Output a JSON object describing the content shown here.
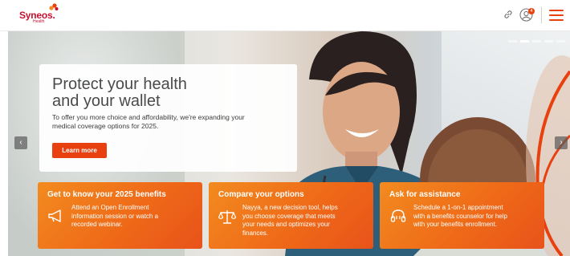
{
  "brand": {
    "name": "Syneos.",
    "sub": "Health",
    "accent": "#e8410f",
    "logo_red": "#c8102e"
  },
  "header": {
    "notification_count": "4",
    "icons": [
      "link-icon",
      "user-icon",
      "menu-icon"
    ]
  },
  "carousel": {
    "total_slides": 5,
    "active_slide": 2,
    "prev_label": "‹",
    "next_label": "›"
  },
  "promo": {
    "title_line1": "Protect your health",
    "title_line2": "and your wallet",
    "body_line1": "To offer you more choice and affordability, we're expanding your",
    "body_line2": "medical coverage options for 2025.",
    "cta_label": "Learn more"
  },
  "cards": [
    {
      "title": "Get to know your 2025 benefits",
      "icon": "megaphone-icon",
      "lines": [
        "Attend an Open Enrollment",
        "information session or watch a",
        "recorded webinar."
      ]
    },
    {
      "title": "Compare your options",
      "icon": "scales-icon",
      "lines": [
        "Nayya, a new decision tool, helps",
        "you choose coverage that meets",
        "your needs and optimizes your",
        "finances."
      ]
    },
    {
      "title": "Ask for assistance",
      "icon": "headset-icon",
      "lines": [
        "Schedule a 1-on-1 appointment",
        "with a benefits counselor for help",
        "with your benefits enrollment."
      ]
    }
  ]
}
